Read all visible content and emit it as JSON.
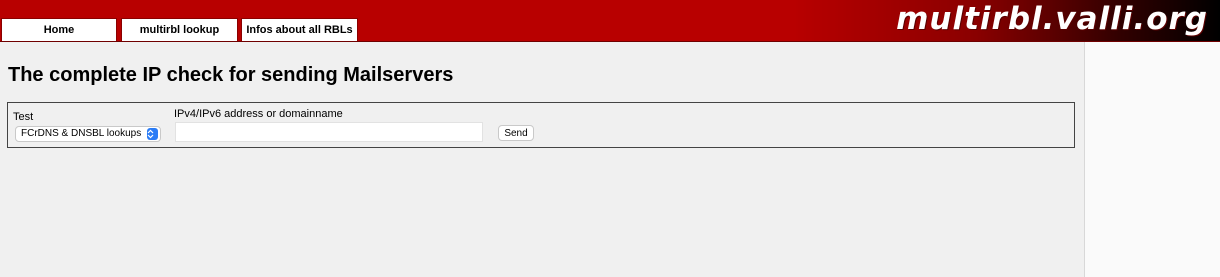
{
  "header": {
    "logo": "multirbl.valli.org",
    "tabs": [
      {
        "label": "Home"
      },
      {
        "label": "multirbl lookup"
      },
      {
        "label": "Infos about all RBLs"
      }
    ]
  },
  "main": {
    "title": "The complete IP check for sending Mailservers",
    "form": {
      "test_label": "Test",
      "test_selected": "FCrDNS & DNSBL lookups",
      "ip_label": "IPv4/IPv6 address or domainname",
      "ip_value": "",
      "ip_placeholder": "",
      "send_label": "Send"
    }
  },
  "colors": {
    "header_red": "#b80000",
    "header_dark": "#000000",
    "select_accent": "#2a7cf6"
  },
  "icons": {
    "select_arrow": "updown-chevron-icon"
  }
}
